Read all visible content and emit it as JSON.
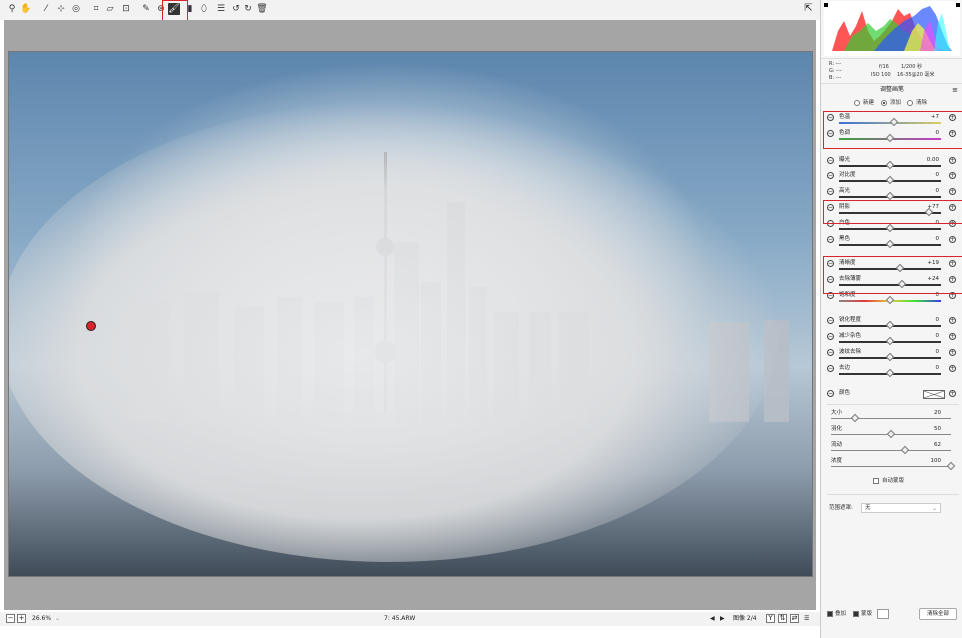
{
  "toolbar": {
    "tools": [
      {
        "name": "zoom-tool",
        "icon": "magnifier-icon",
        "glyph": "⚲"
      },
      {
        "name": "hand-tool",
        "icon": "hand-icon",
        "glyph": "✋"
      },
      {
        "name": "white-balance-tool",
        "icon": "eyedropper-icon",
        "glyph": "⁄"
      },
      {
        "name": "color-sampler-tool",
        "icon": "color-sampler-icon",
        "glyph": "⊹"
      },
      {
        "name": "target-adjust-tool",
        "icon": "target-icon",
        "glyph": "◎"
      },
      {
        "name": "crop-tool",
        "icon": "crop-icon",
        "glyph": "⌗"
      },
      {
        "name": "straighten-tool",
        "icon": "straighten-icon",
        "glyph": "⏥"
      },
      {
        "name": "transform-tool",
        "icon": "transform-icon",
        "glyph": "⊡"
      },
      {
        "name": "spot-removal-tool",
        "icon": "spot-removal-icon",
        "glyph": "✎"
      },
      {
        "name": "red-eye-tool",
        "icon": "red-eye-icon",
        "glyph": "⊛"
      },
      {
        "name": "adjustment-brush-tool",
        "icon": "brush-icon",
        "glyph": "🖌"
      },
      {
        "name": "graduated-filter-tool",
        "icon": "graduated-filter-icon",
        "glyph": "▮"
      },
      {
        "name": "radial-filter-tool",
        "icon": "radial-filter-icon",
        "glyph": "⬯"
      },
      {
        "name": "preferences-tool",
        "icon": "list-icon",
        "glyph": "☰"
      },
      {
        "name": "rotate-left-tool",
        "icon": "rotate-ccw-icon",
        "glyph": "↺"
      },
      {
        "name": "rotate-right-tool",
        "icon": "rotate-cw-icon",
        "glyph": "↻"
      },
      {
        "name": "delete-tool",
        "icon": "trash-icon",
        "glyph": "🗑"
      }
    ],
    "fullscreen_glyph": "⇱"
  },
  "status": {
    "zoom": "26.6%",
    "filename": "7: 45.ARW",
    "image_label": "图像 2/4"
  },
  "exif": {
    "r": "R:  ---",
    "g": "G:  ---",
    "b": "B:  ---",
    "aperture": "f/16",
    "shutter": "1/200 秒",
    "iso": "ISO 100",
    "lens": "16-35@20 毫米"
  },
  "panel": {
    "title": "调整画笔",
    "mode_new": "新建",
    "mode_add": "添加",
    "mode_clear": "清除",
    "sliders": [
      {
        "label": "色温",
        "value": "+7"
      },
      {
        "label": "色调",
        "value": "0"
      },
      {
        "label": "曝光",
        "value": "0.00"
      },
      {
        "label": "对比度",
        "value": "0"
      },
      {
        "label": "高光",
        "value": "0"
      },
      {
        "label": "阴影",
        "value": "+77"
      },
      {
        "label": "白色",
        "value": "0"
      },
      {
        "label": "黑色",
        "value": "0"
      },
      {
        "label": "清晰度",
        "value": "+19"
      },
      {
        "label": "去除薄雾",
        "value": "+24"
      },
      {
        "label": "饱和度",
        "value": "0"
      },
      {
        "label": "锐化程度",
        "value": "0"
      },
      {
        "label": "减少杂色",
        "value": "0"
      },
      {
        "label": "波纹去除",
        "value": "0"
      },
      {
        "label": "去边",
        "value": "0"
      }
    ],
    "color_label": "颜色",
    "brush": [
      {
        "label": "大小",
        "value": "20"
      },
      {
        "label": "羽化",
        "value": "50"
      },
      {
        "label": "流动",
        "value": "62"
      },
      {
        "label": "浓度",
        "value": "100"
      }
    ],
    "auto_mask": "自动蒙版",
    "range_mask_label": "范围遮罩:",
    "range_mask_value": "无",
    "overlay": "叠加",
    "mask": "蒙版",
    "clear_all": "清除全部"
  },
  "colors": {
    "highlight": "#d9232d"
  }
}
